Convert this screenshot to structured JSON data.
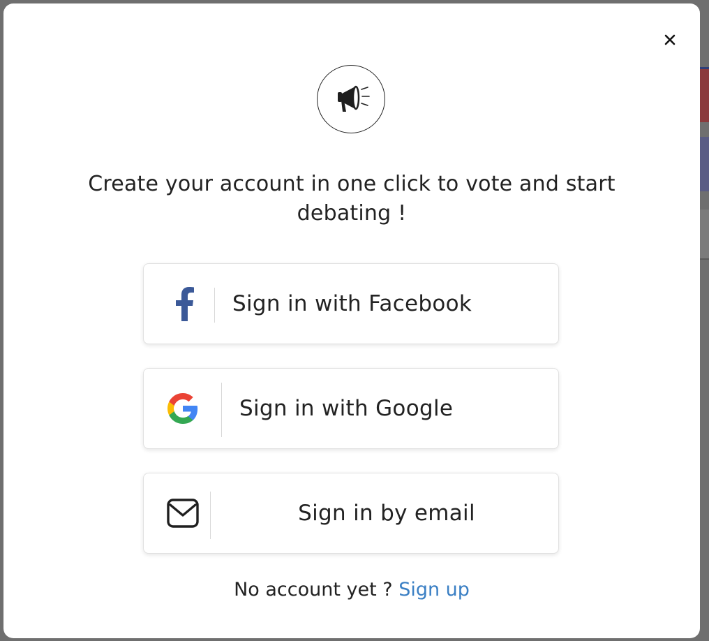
{
  "modal": {
    "close_icon": "close-icon",
    "logo_icon": "megaphone-icon",
    "headline": "Create your account in one click to vote and start debating !"
  },
  "buttons": {
    "facebook": {
      "label": "Sign in with Facebook",
      "icon": "facebook-icon",
      "color": "#3b5998"
    },
    "google": {
      "label": "Sign in with Google",
      "icon": "google-icon"
    },
    "email": {
      "label": "Sign in by email",
      "icon": "envelope-icon"
    }
  },
  "footer": {
    "prompt": "No account yet ?",
    "signup_link": "Sign up",
    "link_color": "#3a7fc4"
  }
}
